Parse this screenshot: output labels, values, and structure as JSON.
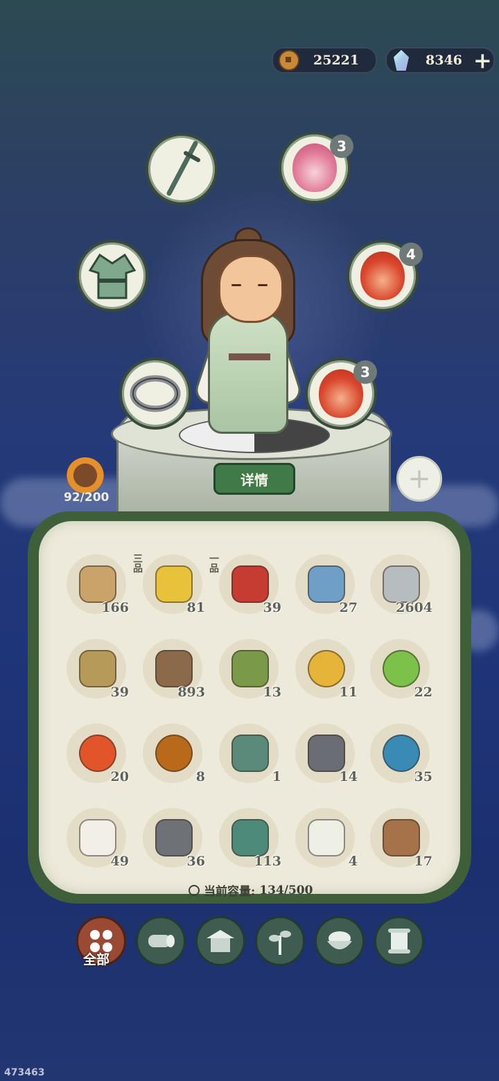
{
  "currency": {
    "coins": "25221",
    "gems": "8346",
    "coin_icon": "copper-coin-icon",
    "gem_icon": "spirit-gem-icon",
    "add_icon": "plus-icon"
  },
  "equipment": {
    "weapon_icon": "sword-icon",
    "armor_icon": "robe-armor-icon",
    "ring_icon": "ring-icon",
    "pets": [
      {
        "icon": "tiger-spirit-icon",
        "level": "3"
      },
      {
        "icon": "lion-spirit-icon",
        "level": "4"
      },
      {
        "icon": "warrior-spirit-icon",
        "level": "3"
      }
    ]
  },
  "character": {
    "detail_label": "详情",
    "stamina": "92/200",
    "add_slot_icon": "plus-icon"
  },
  "inventory": {
    "items": [
      {
        "icon": "scroll-icon",
        "count": "166",
        "grade": ""
      },
      {
        "icon": "yellow-berry-icon",
        "count": "81",
        "grade": "三品"
      },
      {
        "icon": "red-berry-icon",
        "count": "39",
        "grade": "一品"
      },
      {
        "icon": "cloth-bag-icon",
        "count": "27",
        "grade": ""
      },
      {
        "icon": "stone-icon",
        "count": "2604",
        "grade": ""
      },
      {
        "icon": "straw-icon",
        "count": "39",
        "grade": ""
      },
      {
        "icon": "wood-log-icon",
        "count": "893",
        "grade": ""
      },
      {
        "icon": "herb-flower-icon",
        "count": "13",
        "grade": ""
      },
      {
        "icon": "yellow-orb-icon",
        "count": "11",
        "grade": ""
      },
      {
        "icon": "green-orb-icon",
        "count": "22",
        "grade": ""
      },
      {
        "icon": "fire-orb-icon",
        "count": "20",
        "grade": ""
      },
      {
        "icon": "amber-orb-icon",
        "count": "8",
        "grade": ""
      },
      {
        "icon": "jade-ingot-icon",
        "count": "1",
        "grade": ""
      },
      {
        "icon": "iron-ingot-icon",
        "count": "14",
        "grade": ""
      },
      {
        "icon": "spirit-flame-orb-icon",
        "count": "35",
        "grade": ""
      },
      {
        "icon": "silkworm-icon",
        "count": "49",
        "grade": ""
      },
      {
        "icon": "iron-ore-icon",
        "count": "36",
        "grade": ""
      },
      {
        "icon": "jade-ore-icon",
        "count": "113",
        "grade": ""
      },
      {
        "icon": "duck-egg-icon",
        "count": "4",
        "grade": ""
      },
      {
        "icon": "branch-log-icon",
        "count": "17",
        "grade": ""
      }
    ],
    "capacity_label": "当前容量:",
    "capacity_value": "134/500"
  },
  "tabs": [
    {
      "icon": "grid-all-icon",
      "label": "全部",
      "active": true
    },
    {
      "icon": "wood-category-icon",
      "label": "",
      "active": false
    },
    {
      "icon": "building-category-icon",
      "label": "",
      "active": false
    },
    {
      "icon": "herb-category-icon",
      "label": "",
      "active": false
    },
    {
      "icon": "food-bowl-icon",
      "label": "",
      "active": false
    },
    {
      "icon": "scroll-category-icon",
      "label": "",
      "active": false
    }
  ],
  "footer_id": "473463",
  "colors": {
    "panel_border": "#3f5e3a",
    "panel_fill": "#eeeadb",
    "detail_button": "#3f7a48",
    "active_tab": "#9a4a33",
    "tab": "#3e5d50"
  }
}
